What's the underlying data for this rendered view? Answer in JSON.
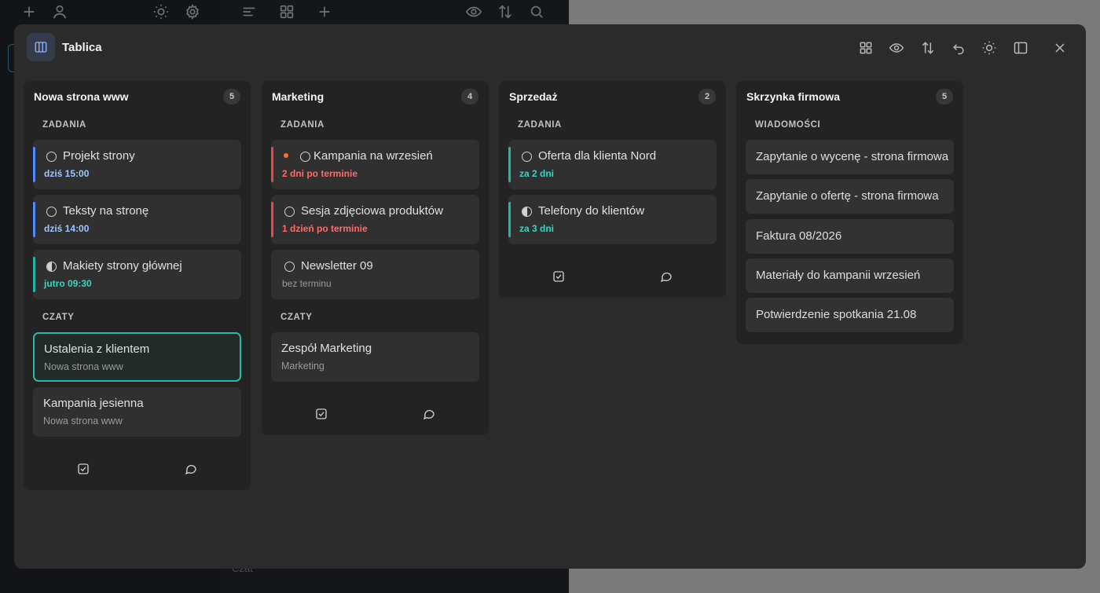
{
  "board": {
    "title": "Tablica",
    "header_icons": [
      "grid-icon",
      "eye-icon",
      "sort-icon",
      "undo-icon",
      "brightness-icon",
      "sidebar-icon",
      "close-icon"
    ]
  },
  "background": {
    "chat_label": "Czat"
  },
  "colors": {
    "accent_blue": "#4f8cff",
    "accent_red": "#e5484d",
    "accent_teal": "#23b5a4",
    "overdue_text": "#ff6b6b",
    "blue_text": "#9ec5ff",
    "teal_text": "#38d6c1"
  },
  "columns": [
    {
      "title": "Nowa strona www",
      "count": "5",
      "sections": [
        {
          "label": "ZADANIA",
          "tasks": [
            {
              "title": "Projekt strony",
              "due": "dziś 15:00"
            },
            {
              "title": "Teksty na stronę",
              "due": "dziś 14:00"
            },
            {
              "title": "Makiety strony głównej",
              "due": "jutro 09:30"
            }
          ]
        },
        {
          "label": "CZATY",
          "chats": [
            {
              "title": "Ustalenia z klientem",
              "project": "Nowa strona www"
            },
            {
              "title": "Kampania jesienna",
              "project": "Nowa strona www"
            }
          ]
        }
      ]
    },
    {
      "title": "Marketing",
      "count": "4",
      "sections": [
        {
          "label": "ZADANIA",
          "tasks": [
            {
              "title": "Kampania na wrzesień",
              "due": "2 dni po terminie"
            },
            {
              "title": "Sesja zdjęciowa produktów",
              "due": "1 dzień po terminie"
            },
            {
              "title": "Newsletter 09",
              "due": "bez terminu"
            }
          ]
        },
        {
          "label": "CZATY",
          "chats": [
            {
              "title": "Zespół Marketing",
              "project": "Marketing"
            }
          ]
        }
      ]
    },
    {
      "title": "Sprzedaż",
      "count": "2",
      "sections": [
        {
          "label": "ZADANIA",
          "tasks": [
            {
              "title": "Oferta dla klienta Nord",
              "due": "za 2 dni"
            },
            {
              "title": "Telefony do klientów",
              "due": "za 3 dni"
            }
          ]
        }
      ]
    },
    {
      "title": "Skrzynka firmowa",
      "count": "5",
      "sections": [
        {
          "label": "WIADOMOŚCI",
          "messages": [
            {
              "title": "Zapytanie o wycenę - strona firmowa"
            },
            {
              "title": "Zapytanie o ofertę - strona firmowa"
            },
            {
              "title": "Faktura 08/2026"
            },
            {
              "title": "Materiały do kampanii wrzesień"
            },
            {
              "title": "Potwierdzenie spotkania 21.08"
            }
          ]
        }
      ]
    }
  ]
}
